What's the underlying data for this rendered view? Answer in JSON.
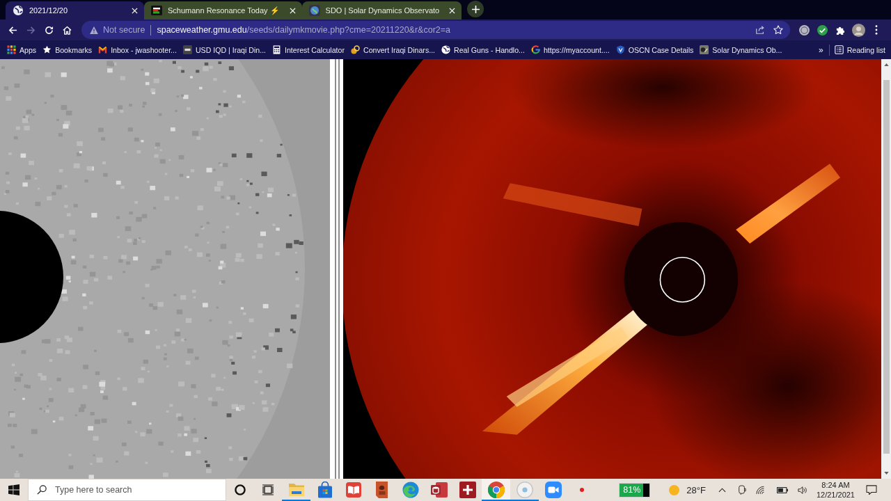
{
  "tabs": [
    {
      "title": "2021/12/20",
      "selected": true
    },
    {
      "title": "Schumann Resonance Today ⚡",
      "selected": false
    },
    {
      "title": "SDO | Solar Dynamics Observato",
      "selected": false
    }
  ],
  "toolbar": {
    "forward": {
      "disabled": true
    },
    "security": "Not secure",
    "url": {
      "host": "spaceweather.gmu.edu",
      "path": "/seeds/dailymkmovie.php?cme=20211220&r&cor2=a"
    }
  },
  "bookmarks": {
    "items": [
      {
        "label": "Apps"
      },
      {
        "label": "Bookmarks"
      },
      {
        "label": "Inbox - jwashooter..."
      },
      {
        "label": "USD IQD | Iraqi Din..."
      },
      {
        "label": "Interest Calculator"
      },
      {
        "label": "Convert Iraqi Dinars..."
      },
      {
        "label": "Real Guns - Handlo..."
      },
      {
        "label": "https://myaccount...."
      },
      {
        "label": "OSCN Case Details"
      },
      {
        "label": "Solar Dynamics Ob..."
      }
    ],
    "overflow": "»",
    "reading_list": "Reading list"
  },
  "taskbar": {
    "search": {
      "placeholder": "Type here to search"
    },
    "apps": [
      {
        "running": true,
        "selected": false
      },
      {
        "running": false,
        "selected": false
      },
      {
        "running": false,
        "selected": false
      },
      {
        "running": false,
        "selected": false
      },
      {
        "running": false,
        "selected": false
      },
      {
        "running": false,
        "selected": false
      },
      {
        "running": false,
        "selected": false
      },
      {
        "running": true,
        "selected": true
      },
      {
        "running": true,
        "selected": false
      },
      {
        "running": false,
        "selected": false
      },
      {
        "running": false,
        "selected": false
      }
    ],
    "battery_meter": "81%",
    "weather": "28°F",
    "clock": {
      "time": "8:24 AM",
      "date": "12/21/2021"
    }
  }
}
